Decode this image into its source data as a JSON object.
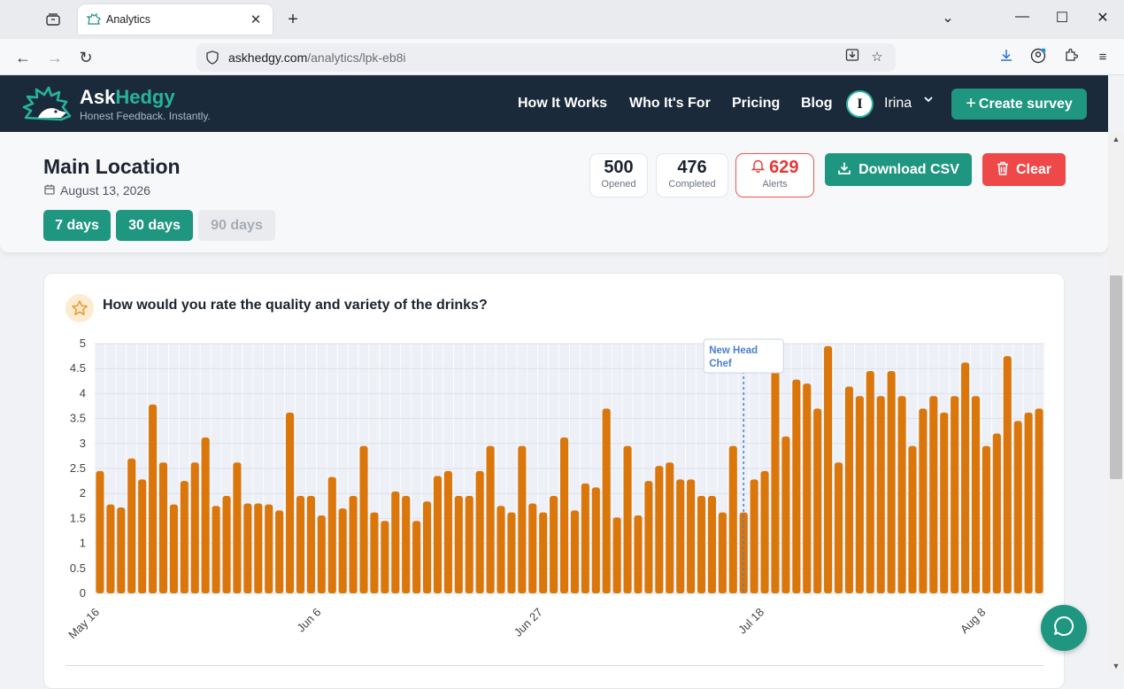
{
  "browser": {
    "tab_title": "Analytics",
    "url_host": "askhedgy.com",
    "url_path": "/analytics/lpk-eb8i"
  },
  "header": {
    "brand_main": "Ask",
    "brand_accent": "Hedgy",
    "tagline": "Honest Feedback. Instantly.",
    "nav": [
      "How It Works",
      "Who It's For",
      "Pricing",
      "Blog"
    ],
    "user_initial": "I",
    "user_name": "Irina",
    "create_label": "Create survey",
    "create_icon": "plus-icon"
  },
  "summary": {
    "location": "Main Location",
    "date": "August 13, 2026",
    "ranges": [
      {
        "label": "7 days",
        "active": true
      },
      {
        "label": "30 days",
        "active": true
      },
      {
        "label": "90 days",
        "active": false
      }
    ],
    "stats": {
      "opened": {
        "value": "500",
        "label": "Opened"
      },
      "completed": {
        "value": "476",
        "label": "Completed"
      },
      "alerts": {
        "value": "629",
        "label": "Alerts"
      }
    },
    "download_label": "Download CSV",
    "clear_label": "Clear"
  },
  "question": {
    "text": "How would you rate the quality and variety of the drinks?",
    "icon": "star-icon"
  },
  "colors": {
    "brand": "#1f9680",
    "accent_text": "#27b39b",
    "bar": "#db760b",
    "danger": "#ef4848",
    "header_bg": "#1b2a3a",
    "annotation": "#4a7fd4"
  },
  "chart_data": {
    "type": "bar",
    "ylim": [
      0,
      5
    ],
    "yticks": [
      "0",
      "0.5",
      "1",
      "1.5",
      "2",
      "2.5",
      "3",
      "3.5",
      "4",
      "4.5",
      "5"
    ],
    "start_date": "May 16",
    "xtick_labels": [
      "May 16",
      "Jun 6",
      "Jun 27",
      "Jul 18",
      "Aug 8"
    ],
    "xtick_index": [
      0,
      21,
      42,
      63,
      84
    ],
    "values": [
      2.45,
      1.78,
      1.72,
      2.7,
      2.28,
      3.78,
      2.62,
      1.78,
      2.25,
      2.62,
      3.12,
      1.75,
      1.95,
      2.62,
      1.8,
      1.8,
      1.78,
      1.66,
      3.62,
      1.95,
      1.95,
      1.56,
      2.33,
      1.7,
      1.95,
      2.95,
      1.62,
      1.45,
      2.04,
      1.95,
      1.45,
      1.84,
      2.35,
      2.45,
      1.95,
      1.95,
      2.45,
      2.95,
      1.75,
      1.62,
      2.95,
      1.8,
      1.62,
      1.95,
      3.12,
      1.66,
      2.2,
      2.12,
      3.7,
      1.52,
      2.95,
      1.56,
      2.25,
      2.55,
      2.62,
      2.28,
      2.28,
      1.95,
      1.95,
      1.62,
      2.95,
      1.62,
      2.28,
      2.45,
      4.5,
      3.14,
      4.28,
      4.2,
      3.7,
      4.95,
      2.62,
      4.14,
      3.95,
      4.45,
      3.95,
      4.45,
      3.95,
      2.95,
      3.7,
      3.95,
      3.62,
      3.95,
      4.62,
      3.95,
      2.95,
      3.2,
      4.75,
      3.45,
      3.62,
      3.7
    ],
    "annotation": {
      "label": "New Head Chef",
      "index": 61
    }
  }
}
